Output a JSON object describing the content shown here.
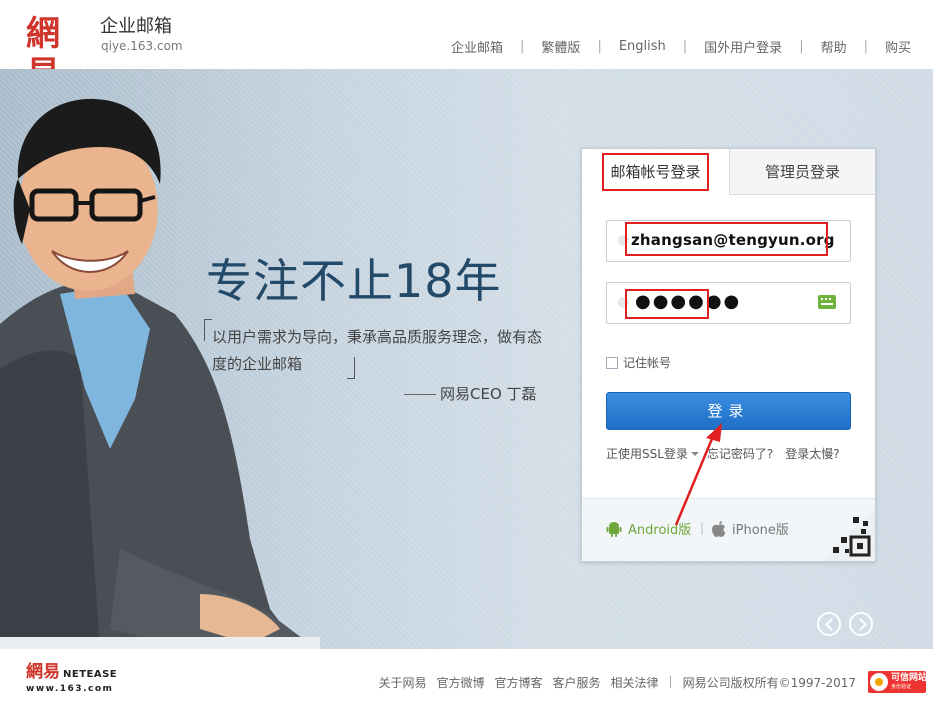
{
  "header": {
    "logo_mark": "網易",
    "logo_title": "企业邮箱",
    "logo_sub": "qiye.163.com",
    "nav": [
      "企业邮箱",
      "繁體版",
      "English",
      "国外用户登录",
      "帮助",
      "购买"
    ]
  },
  "banner": {
    "slogan": "专注不止18年",
    "quote": "以用户需求为导向，秉承高品质服务理念，做有态度的企业邮箱",
    "quote_by": "网易CEO 丁磊"
  },
  "login": {
    "tab_account": "邮箱帐号登录",
    "tab_admin": "管理员登录",
    "username_value": "zhangsan@tengyun.org",
    "password_dots": "●●●●●●",
    "remember_label": "记住帐号",
    "submit_label": "登录",
    "ssl_label": "正使用SSL登录",
    "forgot_label": "忘记密码了?",
    "slow_label": "登录太慢?",
    "android_label": "Android版",
    "iphone_label": "iPhone版"
  },
  "footer": {
    "logo_mark": "網易",
    "logo_ne": "NETEASE",
    "logo_url": "www.163.com",
    "links": [
      "关于网易",
      "官方微博",
      "官方博客",
      "客户服务",
      "相关法律"
    ],
    "copyright": "网易公司版权所有©1997-2017",
    "trust_title": "可信网站",
    "trust_sub": "身份验证"
  },
  "colors": {
    "brand_red": "#d0352b",
    "slogan_blue": "#244a6a",
    "button_blue": "#1e6fc7",
    "annotation_red": "#e02020",
    "android_green": "#6fa63a"
  }
}
